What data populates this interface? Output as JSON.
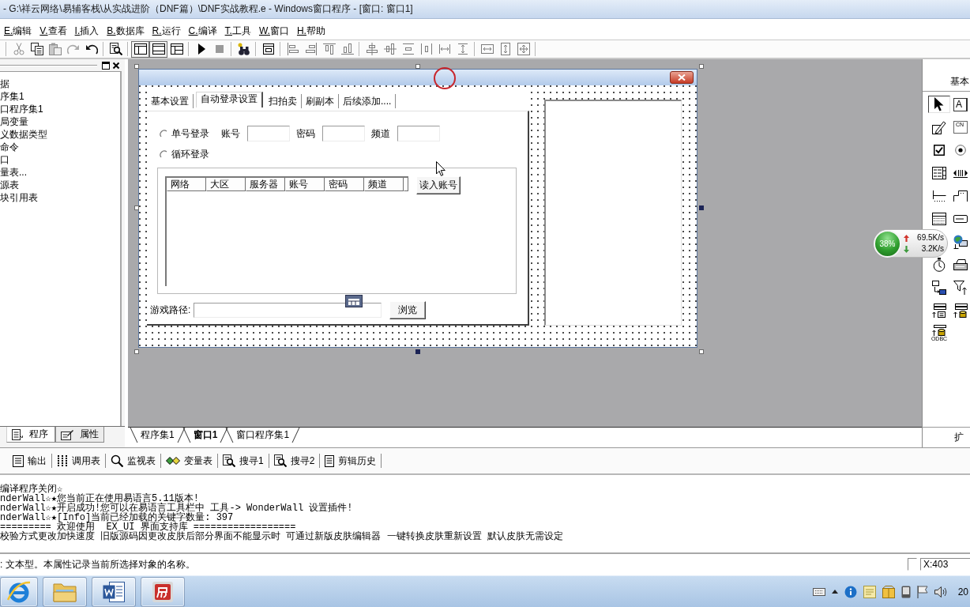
{
  "window": {
    "title": "- G:\\祥云网络\\易辅客栈\\从实战进阶（DNF篇）\\DNF实战教程.e - Windows窗口程序 - [窗口: 窗口1]"
  },
  "menu": [
    "E.编辑",
    "V.查看",
    "I.插入",
    "B.数据库",
    "R.运行",
    "C.编译",
    "T.工具",
    "W.窗口",
    "H.帮助"
  ],
  "toolbar": {
    "view_toggles": [
      {
        "on": true
      },
      {
        "on": true
      },
      {
        "on": false
      }
    ]
  },
  "project_panel": {
    "items": [
      "据",
      "序集1",
      "口程序集1",
      "局变量",
      "义数据类型",
      "命令",
      "口",
      "量表...",
      "源表",
      "块引用表"
    ],
    "tabs": [
      {
        "label": "程序",
        "kind": "program",
        "selected": true
      },
      {
        "label": "属性",
        "kind": "properties",
        "selected": false
      }
    ]
  },
  "form_designer": {
    "form": {
      "tabs": [
        {
          "label": "基本设置",
          "selected": false
        },
        {
          "label": "自动登录设置",
          "selected": true
        },
        {
          "label": "扫拍卖",
          "selected": false
        },
        {
          "label": "刷副本",
          "selected": false
        },
        {
          "label": "后续添加....",
          "selected": false
        }
      ],
      "login_modes": [
        {
          "label": "单号登录",
          "selected": false
        },
        {
          "label": "循环登录",
          "selected": false
        }
      ],
      "fields": [
        {
          "label": "账号"
        },
        {
          "label": "密码"
        },
        {
          "label": "频道"
        }
      ],
      "account_table": {
        "columns": [
          "网络",
          "大区",
          "服务器",
          "账号",
          "密码",
          "频道"
        ]
      },
      "read_button": "读入账号",
      "path_field": {
        "label": "游戏路径:"
      },
      "browse_button": "浏览"
    },
    "document_tabs": [
      {
        "label": "程序集1",
        "selected": false
      },
      {
        "label": "窗口1",
        "selected": true
      },
      {
        "label": "窗口程序集1",
        "selected": false
      }
    ]
  },
  "toolbox": {
    "header": "基本",
    "tools": [
      {
        "kind": "pointer",
        "selected": true
      },
      {
        "kind": "label",
        "glyph": "A",
        "selected": false
      },
      {
        "kind": "edit",
        "selected": false
      },
      {
        "kind": "groupbox",
        "glyph": "CN",
        "selected": false
      },
      {
        "kind": "checkbox",
        "selected": false
      },
      {
        "kind": "radio",
        "selected": false
      },
      {
        "kind": "listbox",
        "selected": false
      },
      {
        "kind": "scrollbar",
        "selected": false
      },
      {
        "kind": "slider",
        "selected": false
      },
      {
        "kind": "tabs",
        "selected": false
      },
      {
        "kind": "calendar",
        "selected": false
      },
      {
        "kind": "panel",
        "selected": false
      },
      {
        "kind": "network",
        "selected": false
      },
      {
        "kind": "timer",
        "selected": false
      },
      {
        "kind": "printer",
        "selected": false
      },
      {
        "kind": "transfer",
        "selected": false
      },
      {
        "kind": "filter",
        "selected": false
      },
      {
        "kind": "filesource",
        "selected": false
      },
      {
        "kind": "dbsource",
        "selected": false
      },
      {
        "kind": "odbc",
        "caption": "ODBC",
        "selected": false
      }
    ],
    "footer": "扩"
  },
  "net_monitor": {
    "usage": "38%",
    "upload": "69.5K/s",
    "download": "3.2K/s"
  },
  "output": {
    "tabs": [
      {
        "label": "输出",
        "kind": "output"
      },
      {
        "label": "调用表",
        "kind": "calls"
      },
      {
        "label": "监视表",
        "kind": "watch"
      },
      {
        "label": "变量表",
        "kind": "variables"
      },
      {
        "label": "搜寻1",
        "kind": "search"
      },
      {
        "label": "搜寻2",
        "kind": "search"
      },
      {
        "label": "剪辑历史",
        "kind": "history"
      }
    ],
    "lines": [
      "编译程序关闭☆",
      "nderWall☆★您当前正在使用易语言5.11版本!",
      "nderWall☆★开启成功!您可以在易语言工具栏中 工具-> WonderWall 设置插件!",
      "nderWall☆★[Info]当前已经加载的关键字数量: 397",
      "========= 欢迎使用  EX_UI 界面支持库 ==================",
      "校验方式更改加快速度 旧版源码因更改皮肤后部分界面不能显示时 可通过新版皮肤编辑器 一键转换皮肤重新设置 默认皮肤无需设定"
    ]
  },
  "status_bar": {
    "text": ": 文本型。本属性记录当前所选择对象的名称。",
    "position": "X:403"
  },
  "tray": {
    "clock": "20"
  }
}
